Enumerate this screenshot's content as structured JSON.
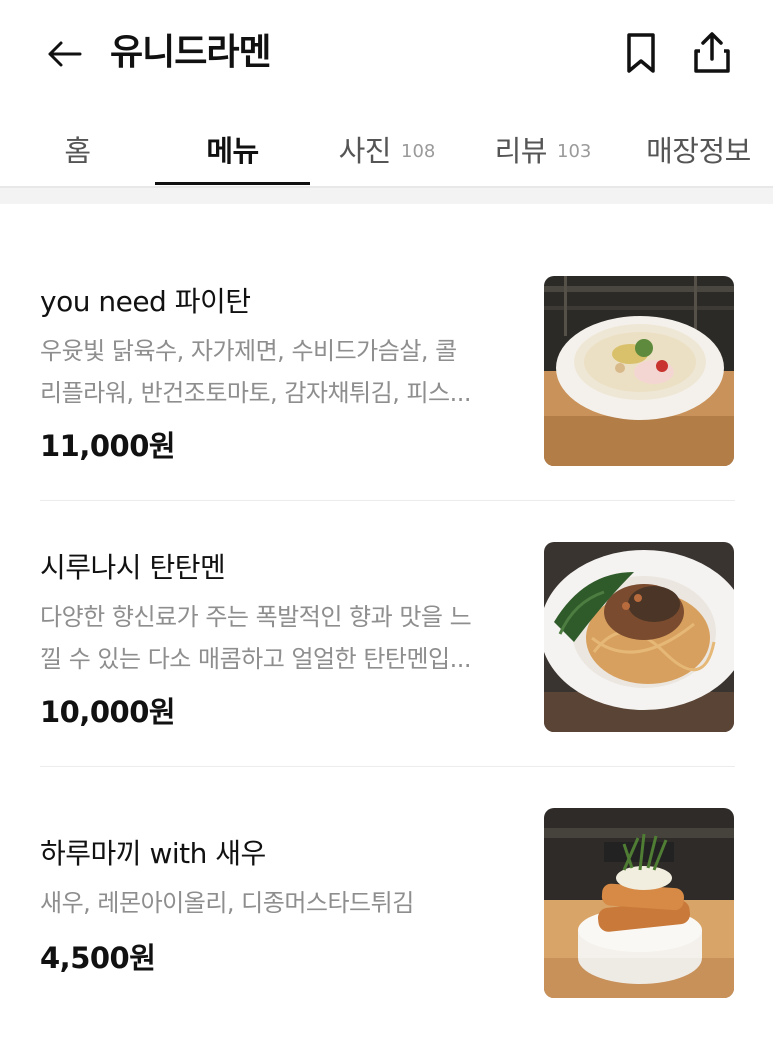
{
  "header": {
    "title": "유니드라멘",
    "back_icon": "arrow-left-icon",
    "bookmark_icon": "bookmark-icon",
    "share_icon": "share-icon"
  },
  "tabs": [
    {
      "label": "홈",
      "count": ""
    },
    {
      "label": "메뉴",
      "count": "",
      "active": true
    },
    {
      "label": "사진",
      "count": "108"
    },
    {
      "label": "리뷰",
      "count": "103"
    },
    {
      "label": "매장정보",
      "count": ""
    }
  ],
  "menu": [
    {
      "name": "you need 파이탄",
      "desc_lines": [
        "우윳빛 닭육수, 자가제면, 수비드가슴살, 콜",
        "리플라워, 반건조토마토, 감자채튀김, 피스..."
      ],
      "price": "11,000원",
      "image": "white-paitan-ramen-bowl"
    },
    {
      "name": "시루나시 탄탄멘",
      "desc_lines": [
        "다양한 향신료가 주는 폭발적인 향과 맛을 느",
        "낄 수 있는 다소 매콤하고 얼얼한 탄탄멘입..."
      ],
      "price": "10,000원",
      "image": "dry-tantanmen-bowl"
    },
    {
      "name": "하루마끼 with 새우",
      "desc_lines": [
        "새우, 레몬아이올리, 디종머스타드튀김"
      ],
      "price": "4,500원",
      "image": "shrimp-harumaki-plate"
    }
  ]
}
